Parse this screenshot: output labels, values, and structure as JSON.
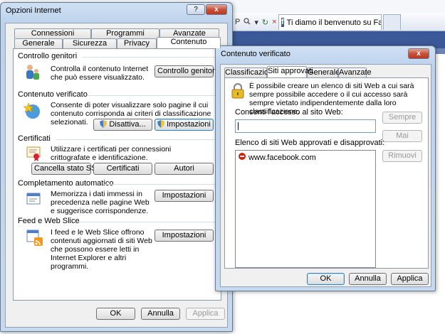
{
  "browser": {
    "address_fragment": "P",
    "tab_title": "Ti diamo il benvenuto su Fa..."
  },
  "internet_options": {
    "title": "Opzioni Internet",
    "help_btn": "?",
    "close_btn": "x",
    "tabs_row1": [
      "Connessioni",
      "Programmi",
      "Avanzate"
    ],
    "tabs_row2": [
      "Generale",
      "Sicurezza",
      "Privacy",
      "Contenuto"
    ],
    "active_tab": "Contenuto",
    "sections": {
      "parental": {
        "label": "Controllo genitori",
        "description": "Controlla il contenuto Internet che può essere visualizzato.",
        "button": "Controllo genitori"
      },
      "advisor": {
        "label": "Contenuto verificato",
        "description": "Consente di poter visualizzare solo pagine il cui contenuto corrisponda ai criteri di classificazione selezionati.",
        "disable_button": "Disattiva...",
        "settings_button": "Impostazioni"
      },
      "certificates": {
        "label": "Certificati",
        "description": "Utilizzare i certificati per connessioni crittografate e identificazione.",
        "clear_ssl_button": "Cancella stato SSL",
        "certificates_button": "Certificati",
        "publishers_button": "Autori"
      },
      "autocomplete": {
        "label": "Completamento automatico",
        "description": "Memorizza i dati immessi in precedenza nelle pagine Web e suggerisce corrispondenze.",
        "button": "Impostazioni"
      },
      "feeds": {
        "label": "Feed e Web Slice",
        "description": "I feed e le Web Slice offrono contenuti aggiornati di siti Web che possono essere letti in Internet Explorer e altri programmi.",
        "button": "Impostazioni"
      }
    },
    "footer": {
      "ok": "OK",
      "cancel": "Annulla",
      "apply": "Applica"
    }
  },
  "content_advisor": {
    "title": "Contenuto verificato",
    "close_btn": "x",
    "tabs": [
      "Classificazioni",
      "Siti approvati",
      "Generale",
      "Avanzate"
    ],
    "active_tab": "Siti approvati",
    "intro": "È possibile creare un elenco di siti Web a cui sarà sempre possibile accedere o il cui accesso sarà sempre vietato indipendentemente dalla loro classificazione.",
    "allow_label": "Consenti l'accesso al sito Web:",
    "site_input_value": "",
    "always_button": "Sempre",
    "never_button": "Mai",
    "list_label": "Elenco di siti Web approvati e disapprovati:",
    "remove_button": "Rimuovi",
    "sites": [
      {
        "url": "www.facebook.com",
        "status": "blocked"
      }
    ],
    "footer": {
      "ok": "OK",
      "cancel": "Annulla",
      "apply": "Applica"
    }
  },
  "colors": {
    "facebook_blue": "#3b5998",
    "blocked_red": "#d81e05",
    "window_frame": "#bcd2ec"
  }
}
